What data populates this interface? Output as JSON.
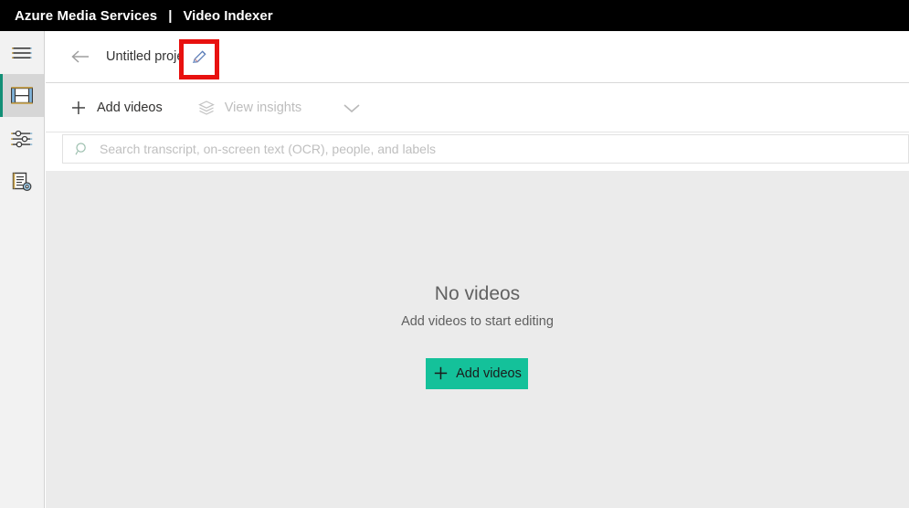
{
  "topbar": {
    "brand": "Azure Media Services",
    "separator": "|",
    "app": "Video Indexer"
  },
  "rail": {
    "items": [
      {
        "name": "menu",
        "icon": "hamburger-menu-icon",
        "label": "",
        "active": false
      },
      {
        "name": "media",
        "icon": "film-strip-icon",
        "label": "",
        "active": true
      },
      {
        "name": "settings",
        "icon": "sliders-icon",
        "label": "",
        "active": false
      },
      {
        "name": "model-customization",
        "icon": "document-gear-icon",
        "label": "",
        "active": false
      }
    ]
  },
  "titlebar": {
    "back_label": "back-arrow",
    "project_name": "Untitled project",
    "edit_icon": "pencil-icon",
    "highlight_color": "#e8110f"
  },
  "toolbar": {
    "add_videos_label": "Add videos",
    "add_videos_icon": "plus-icon",
    "view_insights_label": "View insights",
    "view_insights_icon": "layers-icon",
    "view_insights_disabled": true,
    "chevron_icon": "chevron-down-icon"
  },
  "search": {
    "placeholder": "Search transcript, on-screen text (OCR), people, and labels",
    "value": "",
    "icon": "search-icon"
  },
  "empty_state": {
    "title": "No videos",
    "subtitle": "Add videos to start editing",
    "button_label": "Add videos",
    "button_icon": "plus-icon",
    "button_color": "#14c19a"
  }
}
